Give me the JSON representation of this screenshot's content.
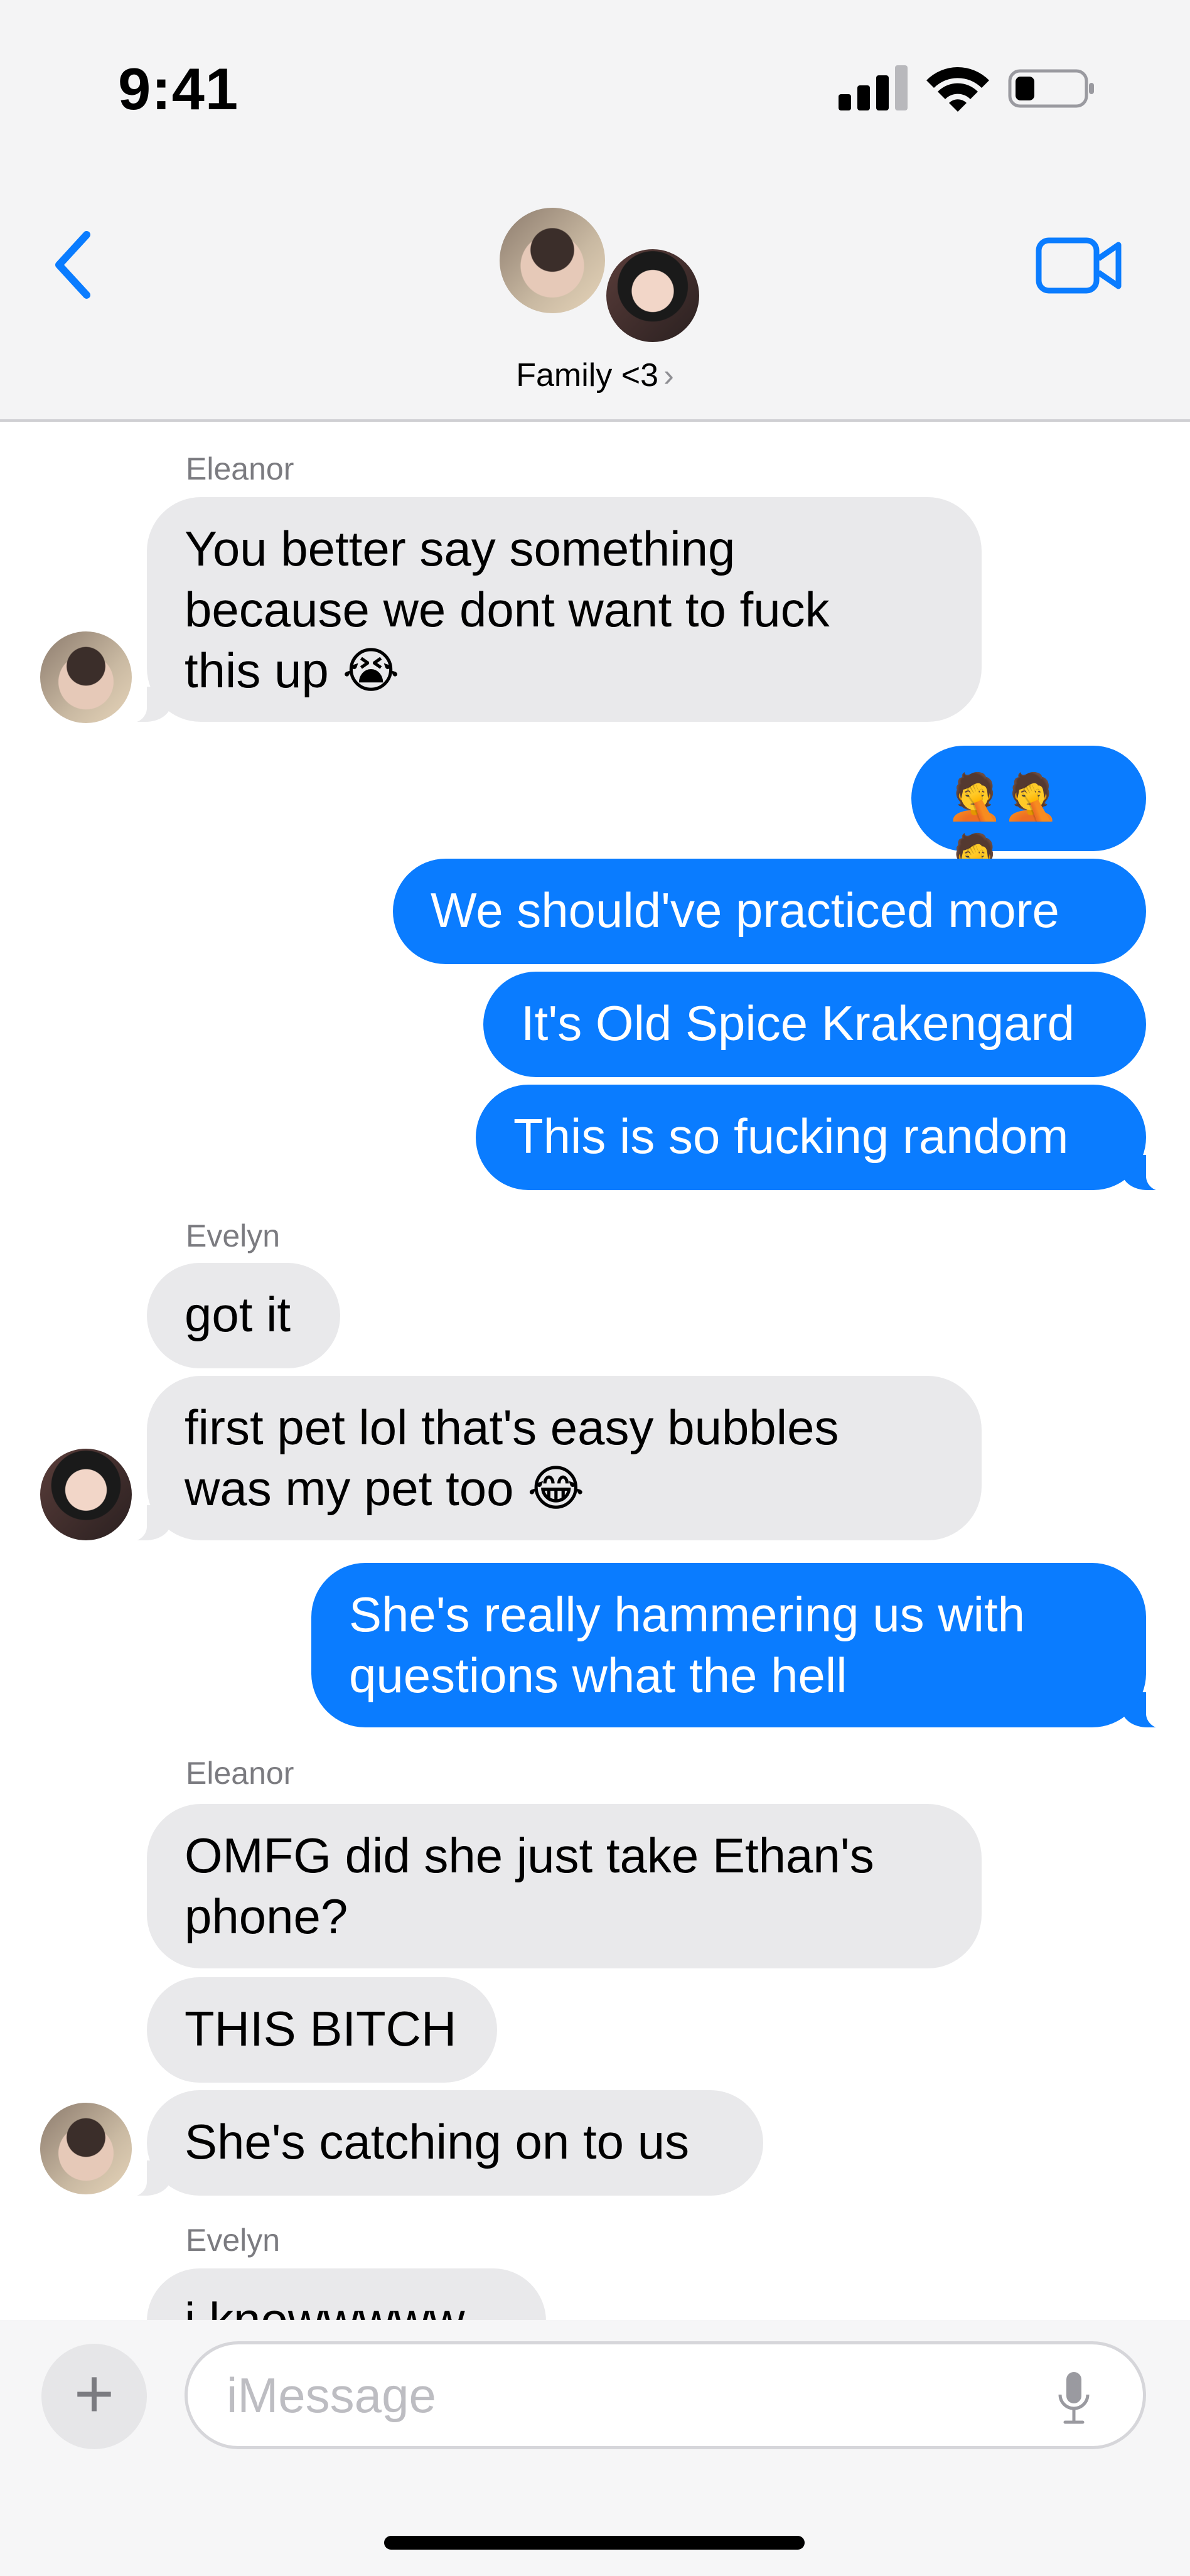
{
  "status_bar": {
    "time": "9:41"
  },
  "header": {
    "group_name": "Family <3",
    "chevron": "›",
    "icons": [
      "back-chevron-icon",
      "video-call-icon"
    ]
  },
  "messages": [
    {
      "sender": "Eleanor",
      "text": "You better say something\nbecause we dont want to fuck\nthis up 😭"
    },
    {
      "text": "🤦🤦🤦"
    },
    {
      "text": "We should've practiced more"
    },
    {
      "text": "It's Old Spice Krakengard"
    },
    {
      "text": "This is so fucking random"
    },
    {
      "sender": "Evelyn",
      "text": "got it"
    },
    {
      "text": "first pet lol that's easy bubbles\nwas my pet too 😂"
    },
    {
      "text": "She's really hammering us with\nquestions what the hell"
    },
    {
      "sender": "Eleanor",
      "text": "OMFG did she just take Ethan's\nphone?"
    },
    {
      "text": "THIS BITCH"
    },
    {
      "text": "She's catching on to us"
    },
    {
      "sender": "Evelyn",
      "text": "i knowwwww"
    }
  ],
  "composer": {
    "plus_label": "+",
    "placeholder": "iMessage"
  },
  "colors": {
    "outgoing_bubble": "#0a7cff",
    "incoming_bubble": "#e9e9eb",
    "accent": "#0a7cff"
  }
}
